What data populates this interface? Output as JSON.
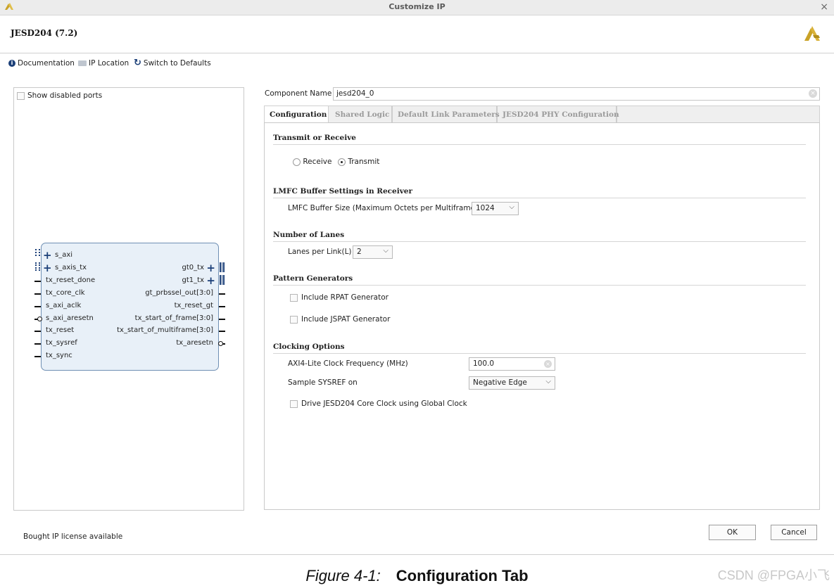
{
  "window": {
    "title": "Customize IP",
    "close_glyph": "×"
  },
  "header": {
    "ip_name": "JESD204 (7.2)"
  },
  "toolbar": {
    "documentation": "Documentation",
    "ip_location": "IP Location",
    "switch_defaults": "Switch to Defaults"
  },
  "symbol_panel": {
    "show_disabled_ports": "Show disabled ports",
    "left_ports": [
      "s_axi",
      "s_axis_tx",
      "tx_reset_done",
      "tx_core_clk",
      "s_axi_aclk",
      "s_axi_aresetn",
      "tx_reset",
      "tx_sysref",
      "tx_sync"
    ],
    "right_ports": [
      "gt0_tx",
      "gt1_tx",
      "gt_prbssel_out[3:0]",
      "tx_reset_gt",
      "tx_start_of_frame[3:0]",
      "tx_start_of_multiframe[3:0]",
      "tx_aresetn"
    ]
  },
  "component": {
    "label": "Component Name",
    "value": "jesd204_0"
  },
  "tabs": [
    "Configuration",
    "Shared Logic",
    "Default Link Parameters",
    "JESD204 PHY Configuration"
  ],
  "config": {
    "transmit_receive": {
      "title": "Transmit or Receive",
      "receive": "Receive",
      "transmit": "Transmit",
      "selected": "Transmit"
    },
    "lmfc": {
      "title": "LMFC Buffer Settings in Receiver",
      "label": "LMFC Buffer Size (Maximum Octets per Multiframe)",
      "value": "1024"
    },
    "lanes": {
      "title": "Number of Lanes",
      "label": "Lanes per Link(L)",
      "value": "2"
    },
    "pattern": {
      "title": "Pattern Generators",
      "rpat": "Include RPAT Generator",
      "jspat": "Include JSPAT Generator"
    },
    "clocking": {
      "title": "Clocking Options",
      "axi_label": "AXI4-Lite Clock Frequency (MHz)",
      "axi_value": "100.0",
      "sysref_label": "Sample SYSREF on",
      "sysref_value": "Negative Edge",
      "drive_label": "Drive JESD204 Core Clock using Global Clock"
    }
  },
  "footer": {
    "license": "Bought IP license available",
    "ok": "OK",
    "cancel": "Cancel"
  },
  "caption": {
    "number": "Figure 4-1:",
    "title": "Configuration Tab"
  },
  "watermark": "CSDN @FPGA小飞",
  "colors": {
    "brand": "#c9a227",
    "accent": "#1b3f78",
    "block_fill": "#e8f0f8",
    "block_border": "#6f8fb3"
  },
  "icons": [
    "xilinx-logo-icon",
    "info-icon",
    "folder-icon",
    "refresh-icon",
    "close-icon",
    "clear-icon",
    "chevron-down-icon",
    "plus-icon",
    "bus-icon"
  ]
}
